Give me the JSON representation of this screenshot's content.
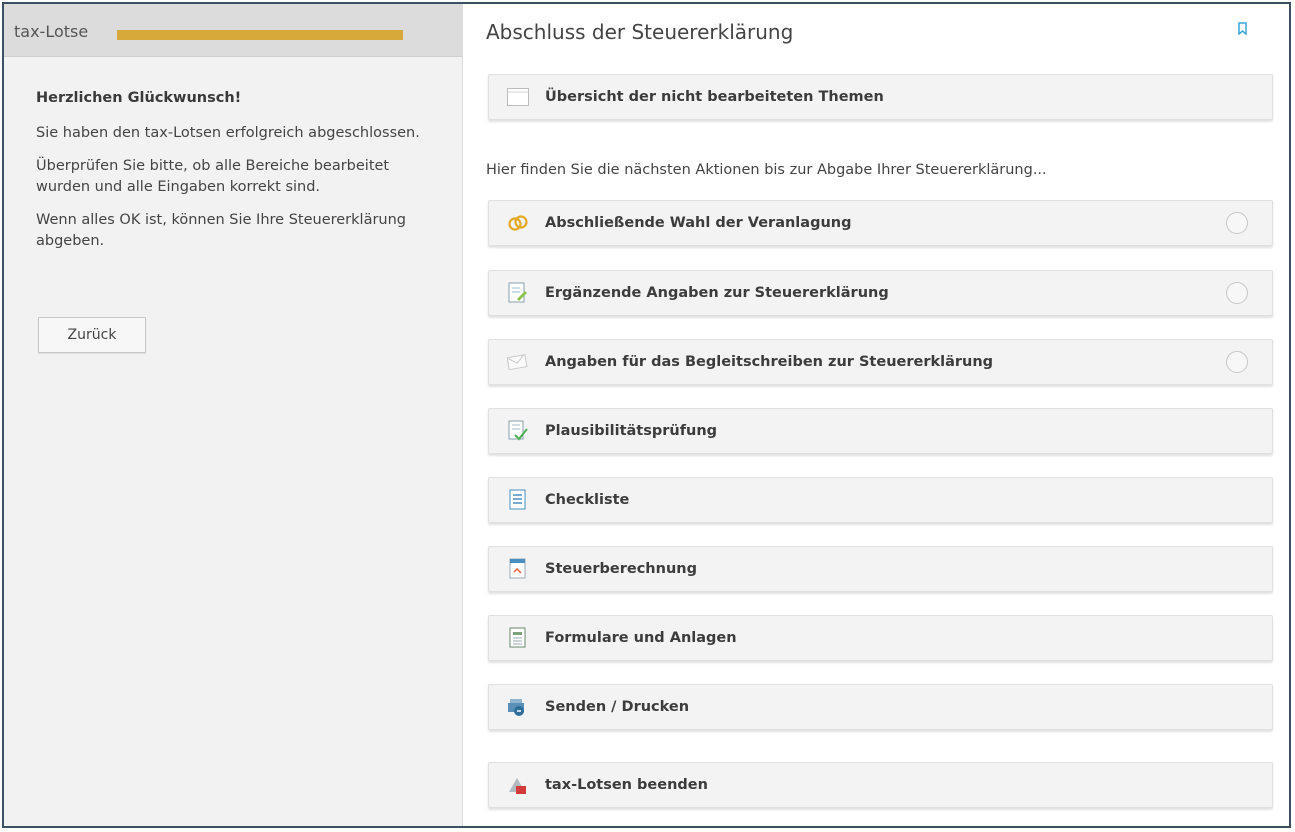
{
  "left": {
    "title": "tax-Lotse",
    "progress_fraction": 1.0,
    "congrats": "Herzlichen Glückwunsch!",
    "para1": "Sie haben den tax-Lotsen erfolgreich abgeschlossen.",
    "para2": "Überprüfen Sie bitte, ob alle Bereiche bearbeitet wurden und alle Eingaben korrekt sind.",
    "para3": "Wenn alles OK ist, können Sie Ihre Steuererklärung abgeben.",
    "back_label": "Zurück"
  },
  "right": {
    "title": "Abschluss der Steuererklärung",
    "overview_label": "Übersicht der nicht bearbeiteten Themen",
    "intro": "Hier finden Sie die nächsten Aktionen bis zur Abgabe Ihrer Steuererklärung...",
    "items": [
      {
        "label": "Abschließende Wahl der Veranlagung",
        "icon": "rings-icon"
      },
      {
        "label": "Ergänzende Angaben zur Steuererklärung",
        "icon": "document-edit-icon"
      },
      {
        "label": "Angaben für das Begleitschreiben zur Steuererklärung",
        "icon": "envelope-icon"
      },
      {
        "label": "Plausibilitätsprüfung",
        "icon": "check-document-icon"
      },
      {
        "label": "Checkliste",
        "icon": "checklist-icon"
      },
      {
        "label": "Steuerberechnung",
        "icon": "calculator-icon"
      },
      {
        "label": "Formulare und Anlagen",
        "icon": "forms-icon"
      },
      {
        "label": "Senden / Drucken",
        "icon": "send-print-icon"
      },
      {
        "label": "tax-Lotsen beenden",
        "icon": "exit-icon"
      }
    ]
  },
  "colors": {
    "accent": "#d6a93a",
    "frame": "#3d4f63",
    "bookmark": "#3aa6d8"
  }
}
